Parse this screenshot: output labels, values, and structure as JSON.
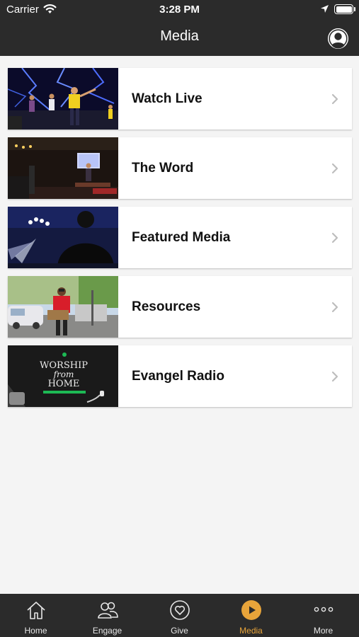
{
  "status_bar": {
    "carrier": "Carrier",
    "time": "3:28 PM"
  },
  "header": {
    "title": "Media"
  },
  "menu": {
    "items": [
      {
        "label": "Watch Live"
      },
      {
        "label": "The Word"
      },
      {
        "label": "Featured Media"
      },
      {
        "label": "Resources"
      },
      {
        "label": "Evangel Radio"
      }
    ]
  },
  "thumb_text": {
    "line1": "WORSHIP",
    "line2": "from",
    "line3": "HOME"
  },
  "tabbar": {
    "tabs": [
      {
        "label": "Home",
        "icon": "home-icon"
      },
      {
        "label": "Engage",
        "icon": "people-icon"
      },
      {
        "label": "Give",
        "icon": "heart-icon"
      },
      {
        "label": "Media",
        "icon": "play-icon"
      },
      {
        "label": "More",
        "icon": "more-icon"
      }
    ],
    "active": "Media"
  },
  "colors": {
    "bar_background": "#2b2b2b",
    "accent": "#e8a43a",
    "page_background": "#f4f4f4"
  }
}
